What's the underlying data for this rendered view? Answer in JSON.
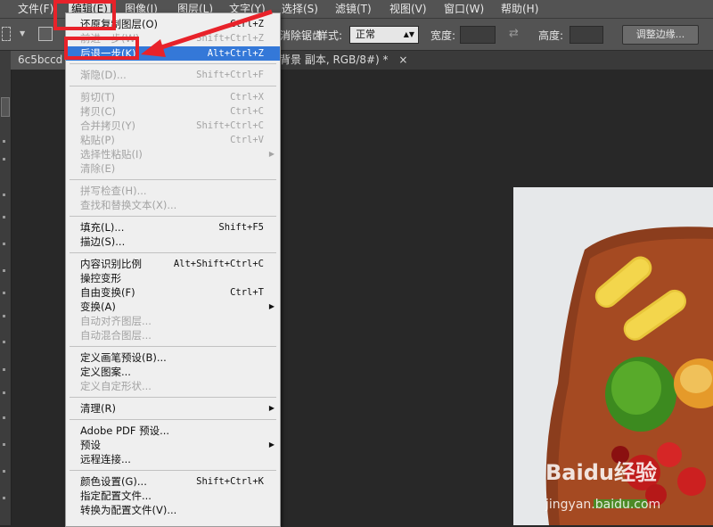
{
  "menubar": {
    "items": [
      "文件(F)",
      "编辑(E)",
      "图像(I)",
      "图层(L)",
      "文字(Y)",
      "选择(S)",
      "滤镜(T)",
      "视图(V)",
      "窗口(W)",
      "帮助(H)"
    ]
  },
  "options": {
    "antialias": "消除锯齿",
    "style_label": "样式:",
    "style_value": "正常",
    "width_label": "宽度:",
    "height_label": "高度:",
    "refine_button": "调整边缘..."
  },
  "tabs": {
    "tab1": "6c5bccd",
    "tab2": "背景 副本, RGB/8#) *",
    "close": "×"
  },
  "menu": {
    "rows": [
      {
        "label": "还原复制图层(O)",
        "shortcut": "Ctrl+Z",
        "disabled": false
      },
      {
        "label": "前进一步(W)",
        "shortcut": "Shift+Ctrl+Z",
        "disabled": true
      },
      {
        "label": "后退一步(K)",
        "shortcut": "Alt+Ctrl+Z",
        "highlighted": true
      },
      {
        "label": "渐隐(D)...",
        "shortcut": "Shift+Ctrl+F",
        "disabled": true
      },
      {
        "label": "剪切(T)",
        "shortcut": "Ctrl+X",
        "disabled": true
      },
      {
        "label": "拷贝(C)",
        "shortcut": "Ctrl+C",
        "disabled": true
      },
      {
        "label": "合并拷贝(Y)",
        "shortcut": "Shift+Ctrl+C",
        "disabled": true
      },
      {
        "label": "粘贴(P)",
        "shortcut": "Ctrl+V",
        "disabled": true
      },
      {
        "label": "选择性粘贴(I)",
        "shortcut": "",
        "disabled": true,
        "submenu": true
      },
      {
        "label": "清除(E)",
        "shortcut": "",
        "disabled": true
      },
      {
        "label": "拼写检查(H)...",
        "shortcut": "",
        "disabled": true
      },
      {
        "label": "查找和替换文本(X)...",
        "shortcut": "",
        "disabled": true
      },
      {
        "label": "填充(L)...",
        "shortcut": "Shift+F5",
        "disabled": false
      },
      {
        "label": "描边(S)...",
        "shortcut": "",
        "disabled": false
      },
      {
        "label": "内容识别比例",
        "shortcut": "Alt+Shift+Ctrl+C",
        "disabled": false
      },
      {
        "label": "操控变形",
        "shortcut": "",
        "disabled": false
      },
      {
        "label": "自由变换(F)",
        "shortcut": "Ctrl+T",
        "disabled": false
      },
      {
        "label": "变换(A)",
        "shortcut": "",
        "disabled": false,
        "submenu": true
      },
      {
        "label": "自动对齐图层...",
        "shortcut": "",
        "disabled": true
      },
      {
        "label": "自动混合图层...",
        "shortcut": "",
        "disabled": true
      },
      {
        "label": "定义画笔预设(B)...",
        "shortcut": "",
        "disabled": false
      },
      {
        "label": "定义图案...",
        "shortcut": "",
        "disabled": false
      },
      {
        "label": "定义自定形状...",
        "shortcut": "",
        "disabled": true
      },
      {
        "label": "清理(R)",
        "shortcut": "",
        "disabled": false,
        "submenu": true
      },
      {
        "label": "Adobe PDF 预设...",
        "shortcut": "",
        "disabled": false
      },
      {
        "label": "预设",
        "shortcut": "",
        "disabled": false,
        "submenu": true
      },
      {
        "label": "远程连接...",
        "shortcut": "",
        "disabled": false
      },
      {
        "label": "颜色设置(G)...",
        "shortcut": "Shift+Ctrl+K",
        "disabled": false
      },
      {
        "label": "指定配置文件...",
        "shortcut": "",
        "disabled": false
      },
      {
        "label": "转换为配置文件(V)...",
        "shortcut": "",
        "disabled": false
      }
    ]
  },
  "watermark": {
    "brand": "Baidu经验",
    "url": "jingyan.baidu.com"
  },
  "colors": {
    "highlight": "#3478d8",
    "annotation": "#e8222a"
  },
  "icons": [
    "marquee-square-icon",
    "swap-arrows-icon",
    "submenu-arrow-icon",
    "close-icon"
  ]
}
